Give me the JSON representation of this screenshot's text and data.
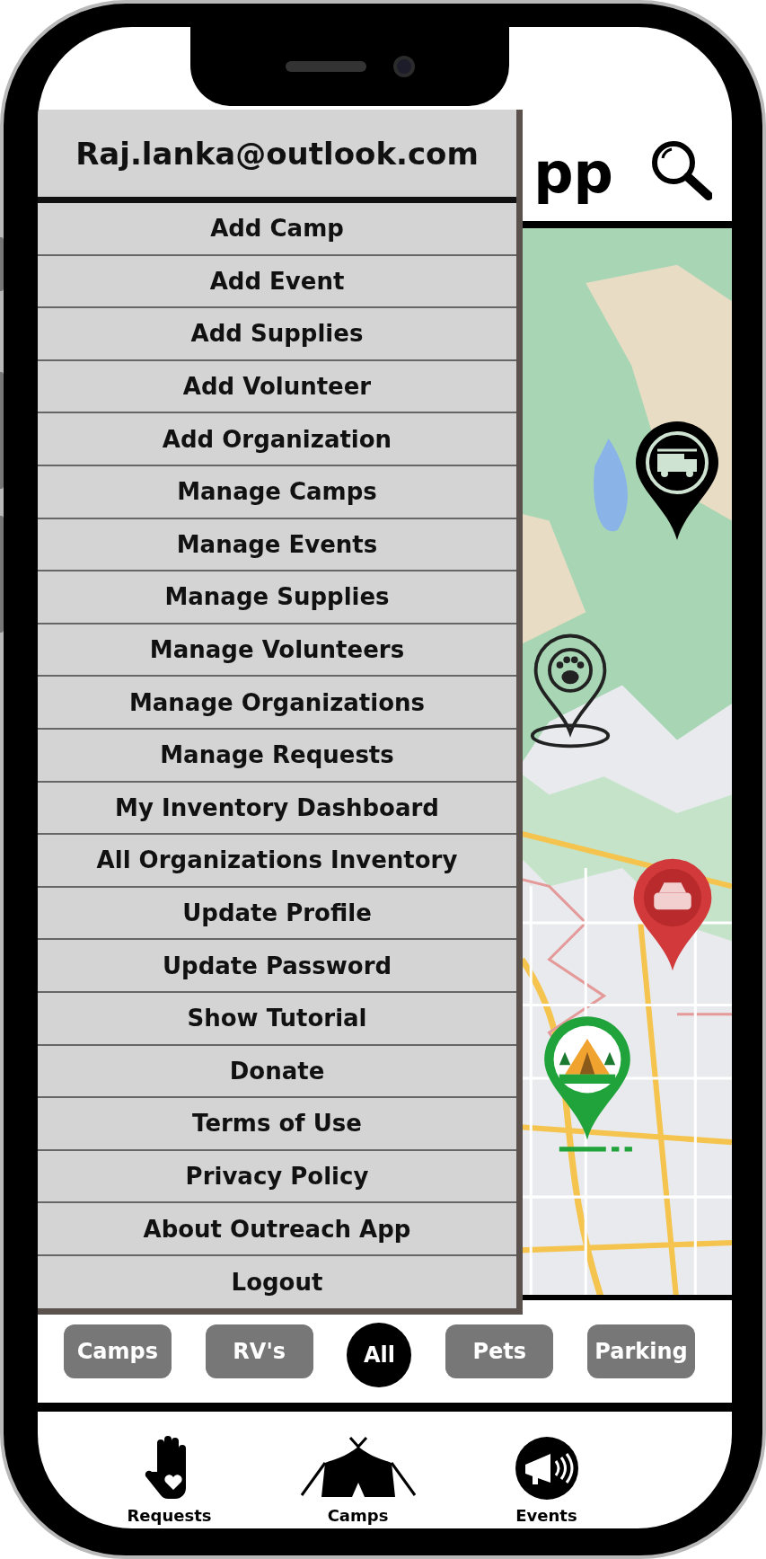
{
  "header": {
    "title": "pp"
  },
  "account": {
    "email": "Raj.lanka@outlook.com"
  },
  "menu": [
    {
      "label": "Add Camp"
    },
    {
      "label": "Add Event"
    },
    {
      "label": "Add Supplies"
    },
    {
      "label": "Add Volunteer"
    },
    {
      "label": "Add Organization"
    },
    {
      "label": "Manage Camps"
    },
    {
      "label": "Manage Events"
    },
    {
      "label": "Manage Supplies"
    },
    {
      "label": "Manage Volunteers"
    },
    {
      "label": "Manage Organizations"
    },
    {
      "label": "Manage Requests"
    },
    {
      "label": "My Inventory Dashboard"
    },
    {
      "label": "All Organizations Inventory"
    },
    {
      "label": "Update Profile"
    },
    {
      "label": "Update Password"
    },
    {
      "label": "Show Tutorial"
    },
    {
      "label": "Donate"
    },
    {
      "label": "Terms of Use"
    },
    {
      "label": "Privacy Policy"
    },
    {
      "label": "About Outreach App"
    },
    {
      "label": "Logout"
    }
  ],
  "map": {
    "pins": [
      {
        "kind": "truck"
      },
      {
        "kind": "paw"
      },
      {
        "kind": "car"
      },
      {
        "kind": "tent"
      }
    ]
  },
  "filters": [
    {
      "label": "Camps",
      "selected": false
    },
    {
      "label": "RV's",
      "selected": false
    },
    {
      "label": "All",
      "selected": true
    },
    {
      "label": "Pets",
      "selected": false
    },
    {
      "label": "Parking",
      "selected": false
    }
  ],
  "tabs": [
    {
      "label": "Requests",
      "kind": "hand"
    },
    {
      "label": "Camps",
      "kind": "tent"
    },
    {
      "label": "Events",
      "kind": "megaphone"
    }
  ]
}
